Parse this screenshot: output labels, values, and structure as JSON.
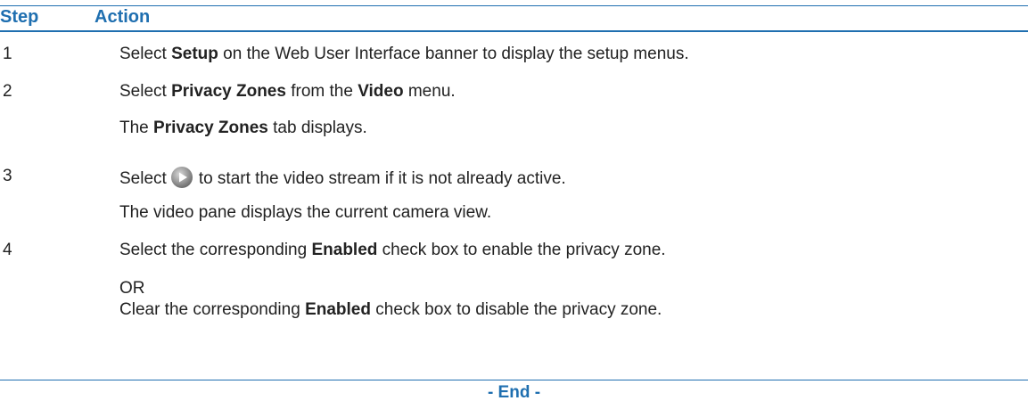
{
  "table": {
    "headers": {
      "step": "Step",
      "action": "Action"
    },
    "rows": [
      {
        "step": "1",
        "lines": [
          {
            "t1": "Select ",
            "b1": "Setup",
            "t2": " on the Web User Interface banner to display the setup menus."
          }
        ]
      },
      {
        "step": "2",
        "lines": [
          {
            "t1": "Select ",
            "b1": "Privacy Zones",
            "t2": " from the ",
            "b2": "Video",
            "t3": " menu."
          },
          {
            "t1": "The ",
            "b1": "Privacy Zones",
            "t2": " tab displays."
          }
        ]
      },
      {
        "step": "3",
        "lines": [
          {
            "t1": "Select",
            "icon": "play-button-icon",
            "t2": "to start the video stream if it is not already active."
          },
          {
            "t1": "The video pane displays the current camera view."
          }
        ]
      },
      {
        "step": "4",
        "lines": [
          {
            "t1": "Select the corresponding ",
            "b1": "Enabled",
            "t2": " check box to enable the privacy zone."
          },
          {
            "t1": "OR"
          },
          {
            "t1": "Clear the corresponding ",
            "b1": "Enabled",
            "t2": " check box to disable the privacy zone."
          }
        ]
      }
    ]
  },
  "footer": {
    "end_label": "- End -"
  },
  "colors": {
    "accent": "#1f6fb0",
    "text": "#222222"
  }
}
